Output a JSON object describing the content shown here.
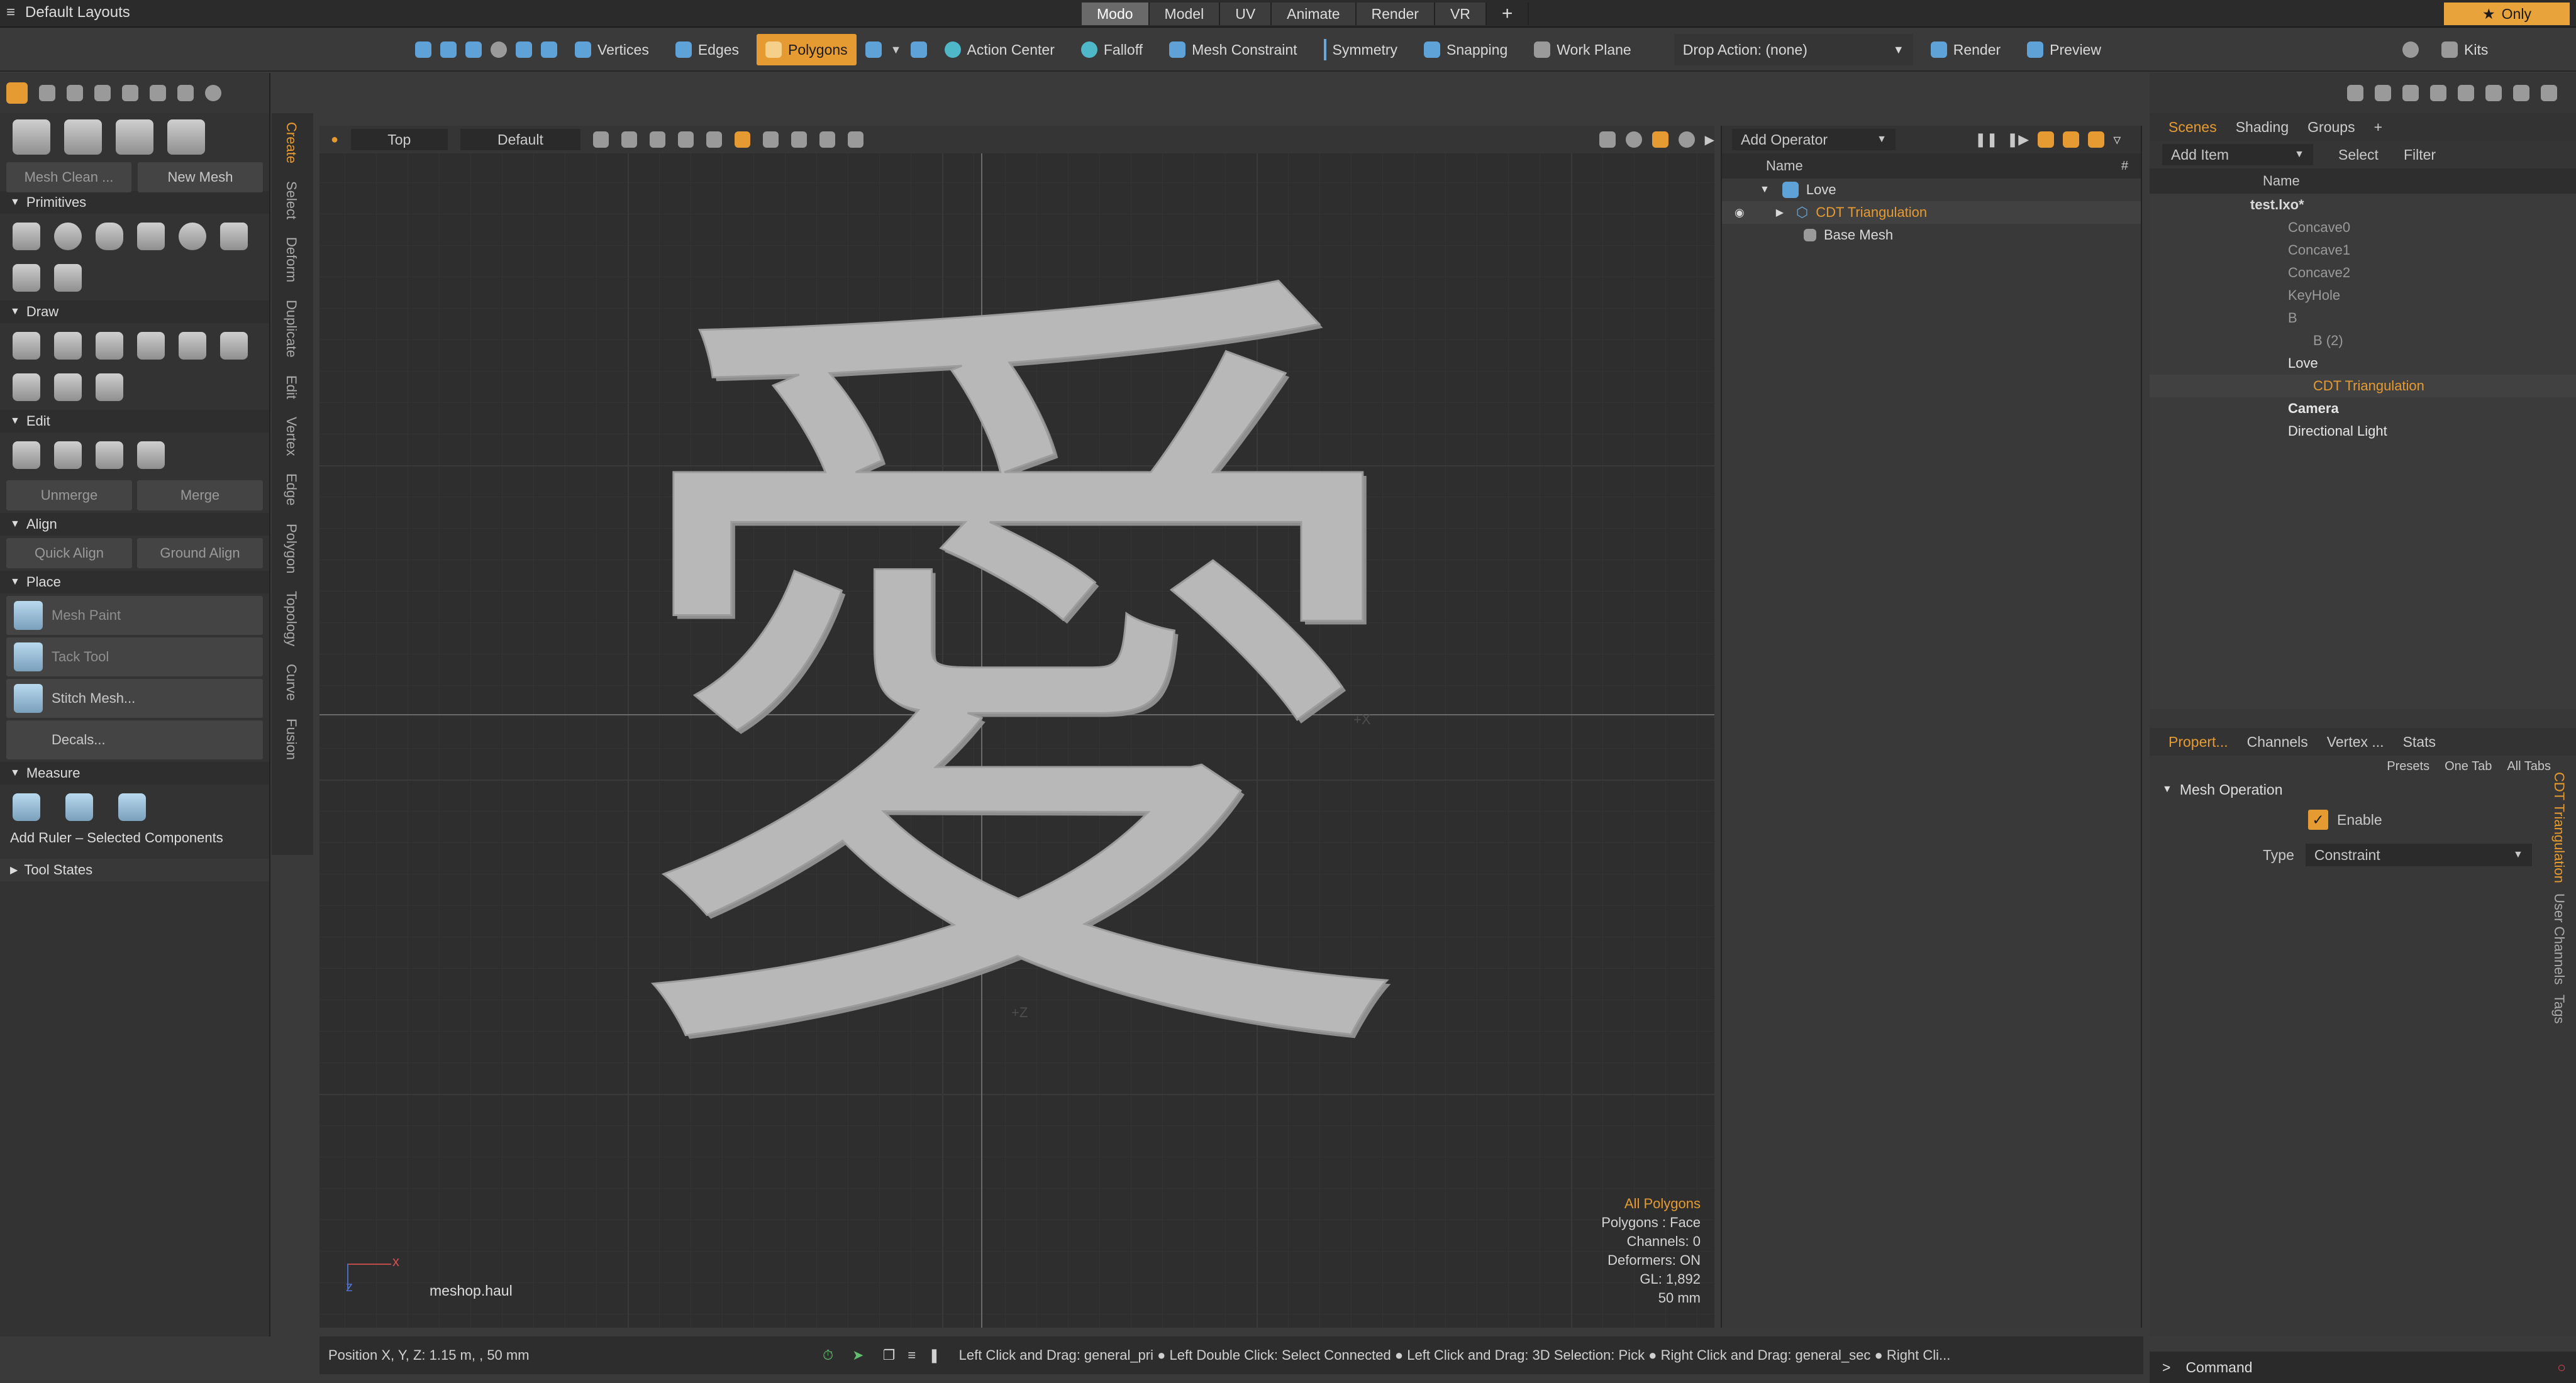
{
  "window": {
    "menu_title": "Default Layouts"
  },
  "layout_tabs": [
    "Modo",
    "Model",
    "UV",
    "Animate",
    "Render",
    "VR"
  ],
  "only_label": "Only",
  "main_toolbar": {
    "vertices": "Vertices",
    "edges": "Edges",
    "polygons": "Polygons",
    "action_center": "Action Center",
    "falloff": "Falloff",
    "mesh_constraint": "Mesh Constraint",
    "symmetry": "Symmetry",
    "snapping": "Snapping",
    "work_plane": "Work Plane",
    "drop_action": "Drop Action: (none)",
    "render": "Render",
    "preview": "Preview",
    "kits": "Kits"
  },
  "left_panel": {
    "mesh_clean": "Mesh Clean ...",
    "new_mesh": "New Mesh",
    "sections": {
      "primitives": "Primitives",
      "draw": "Draw",
      "edit": "Edit",
      "align": "Align",
      "place": "Place",
      "measure": "Measure"
    },
    "unmerge": "Unmerge",
    "merge": "Merge",
    "quick_align": "Quick Align",
    "ground_align": "Ground Align",
    "mesh_paint": "Mesh Paint",
    "tack_tool": "Tack Tool",
    "stitch_mesh": "Stitch Mesh...",
    "decals": "Decals...",
    "add_ruler": "Add Ruler – Selected Components",
    "tool_states": "Tool States"
  },
  "vertical_tabs": [
    "Create",
    "Select",
    "Deform",
    "Duplicate",
    "Edit",
    "Vertex",
    "Edge",
    "Polygon",
    "Topology",
    "Curve",
    "Fusion"
  ],
  "viewport": {
    "view": "Top",
    "shading": "Default",
    "character": "愛",
    "axis_labels": [
      "+X",
      "+Z"
    ],
    "corner_label": "meshop.haul",
    "info": {
      "selection": "All Polygons",
      "polygons": "Polygons : Face",
      "channels": "Channels: 0",
      "deformers": "Deformers: ON",
      "gl": "GL: 1,892",
      "grid": "50 mm"
    }
  },
  "mesh_ops": {
    "add_operator": "Add Operator",
    "col_name": "Name",
    "col_hash": "#",
    "items": [
      {
        "label": "Love",
        "level": 0,
        "highlight": false
      },
      {
        "label": "CDT Triangulation",
        "level": 1,
        "highlight": true
      },
      {
        "label": "Base Mesh",
        "level": 1,
        "highlight": false
      }
    ]
  },
  "scenes": {
    "tabs": [
      "Scenes",
      "Shading",
      "Groups"
    ],
    "add_item": "Add Item",
    "select": "Select",
    "filter": "Filter",
    "col_name": "Name",
    "tree": [
      {
        "label": "test.lxo*",
        "level": 0,
        "style": "bold"
      },
      {
        "label": "Concave0",
        "level": 1,
        "style": "dim"
      },
      {
        "label": "Concave1",
        "level": 1,
        "style": "dim"
      },
      {
        "label": "Concave2",
        "level": 1,
        "style": "dim"
      },
      {
        "label": "KeyHole",
        "level": 1,
        "style": "dim"
      },
      {
        "label": "B",
        "level": 1,
        "style": "dim"
      },
      {
        "label": "B (2)",
        "level": 2,
        "style": "dim"
      },
      {
        "label": "Love",
        "level": 1,
        "style": "normal"
      },
      {
        "label": "CDT Triangulation",
        "level": 2,
        "style": "orange"
      },
      {
        "label": "Camera",
        "level": 1,
        "style": "bold"
      },
      {
        "label": "Directional Light",
        "level": 1,
        "style": "normal"
      }
    ]
  },
  "properties": {
    "tabs": [
      "Propert...",
      "Channels",
      "Vertex ...",
      "Stats"
    ],
    "presets": "Presets",
    "one_tab": "One Tab",
    "all_tabs": "All Tabs",
    "section": "Mesh Operation",
    "enable_label": "Enable",
    "type_label": "Type",
    "type_value": "Constraint",
    "side_tabs": [
      "CDT Triangulation",
      "User Channels",
      "Tags"
    ]
  },
  "status": {
    "position": "Position X, Y, Z:  1.15 m, , 50 mm",
    "hints": "Left Click and Drag: general_pri ● Left Double Click: Select Connected ● Left Click and Drag: 3D Selection: Pick ● Right Click and Drag: general_sec ● Right Cli..."
  },
  "command": {
    "prompt": ">",
    "label": "Command"
  },
  "colors": {
    "accent": "#e59b32",
    "background": "#2e2e2e"
  }
}
